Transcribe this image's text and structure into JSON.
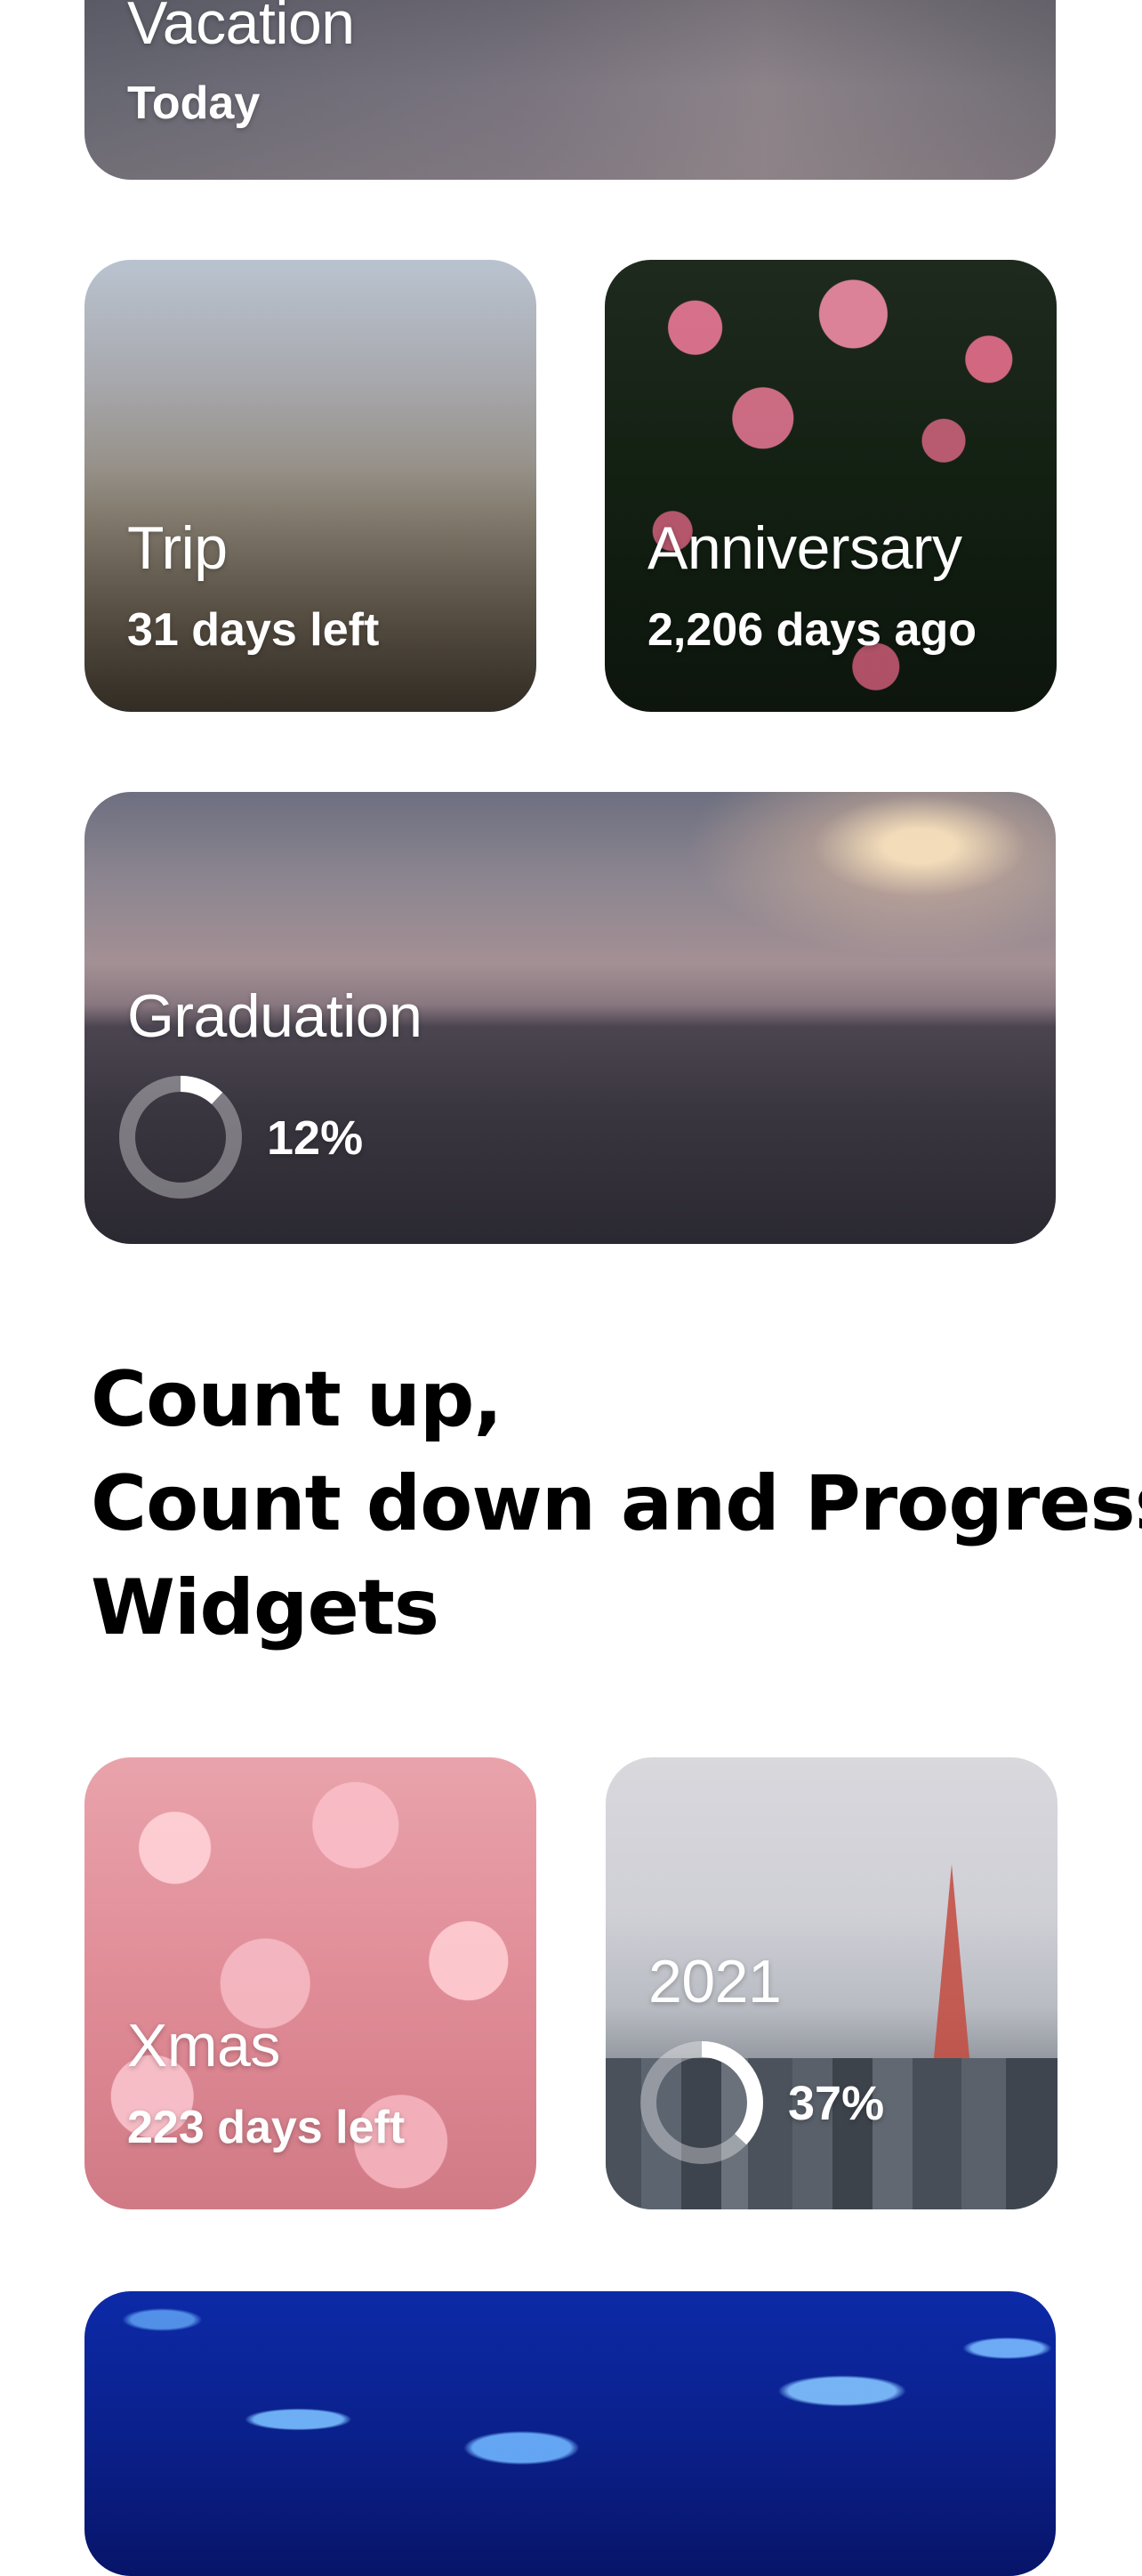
{
  "widgets": {
    "vacation": {
      "title": "Vacation",
      "subtitle": "Today"
    },
    "trip": {
      "title": "Trip",
      "subtitle": "31 days left"
    },
    "anniversary": {
      "title": "Anniversary",
      "subtitle": "2,206 days ago"
    },
    "graduation": {
      "title": "Graduation",
      "progress_text": "12%",
      "progress": 0.12
    },
    "xmas": {
      "title": "Xmas",
      "subtitle": "223 days left"
    },
    "year2021": {
      "title": "2021",
      "progress_text": "37%",
      "progress": 0.37
    }
  },
  "heading": {
    "line1": "Count up,",
    "line2": "Count down and Progress",
    "line3": "Widgets"
  },
  "colors": {
    "ring_track": "rgba(255,255,255,0.35)",
    "ring_fill": "#ffffff",
    "heading_text": "#000000"
  }
}
